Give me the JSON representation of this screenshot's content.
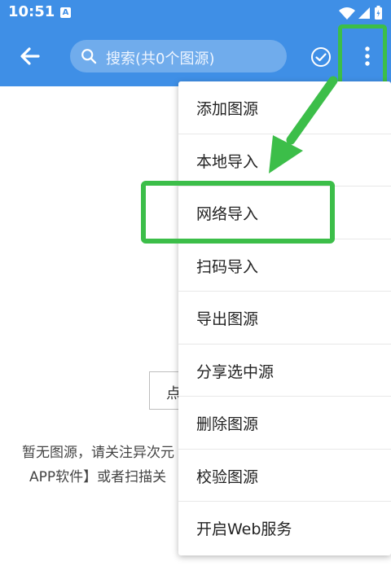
{
  "status_bar": {
    "time": "10:51",
    "notification_icon": "A"
  },
  "toolbar": {
    "search_placeholder": "搜索(共0个图源)"
  },
  "background": {
    "button_label": "点",
    "empty_text_line1": "暂无图源，请关注异次元",
    "empty_text_line2": "APP软件】或者扫描关"
  },
  "menu": {
    "items": [
      {
        "label": "添加图源"
      },
      {
        "label": "本地导入"
      },
      {
        "label": "网络导入"
      },
      {
        "label": "扫码导入"
      },
      {
        "label": "导出图源"
      },
      {
        "label": "分享选中源"
      },
      {
        "label": "删除图源"
      },
      {
        "label": "校验图源"
      },
      {
        "label": "开启Web服务"
      }
    ]
  },
  "colors": {
    "primary": "#3f8fe6",
    "highlight": "#3cbe49"
  }
}
